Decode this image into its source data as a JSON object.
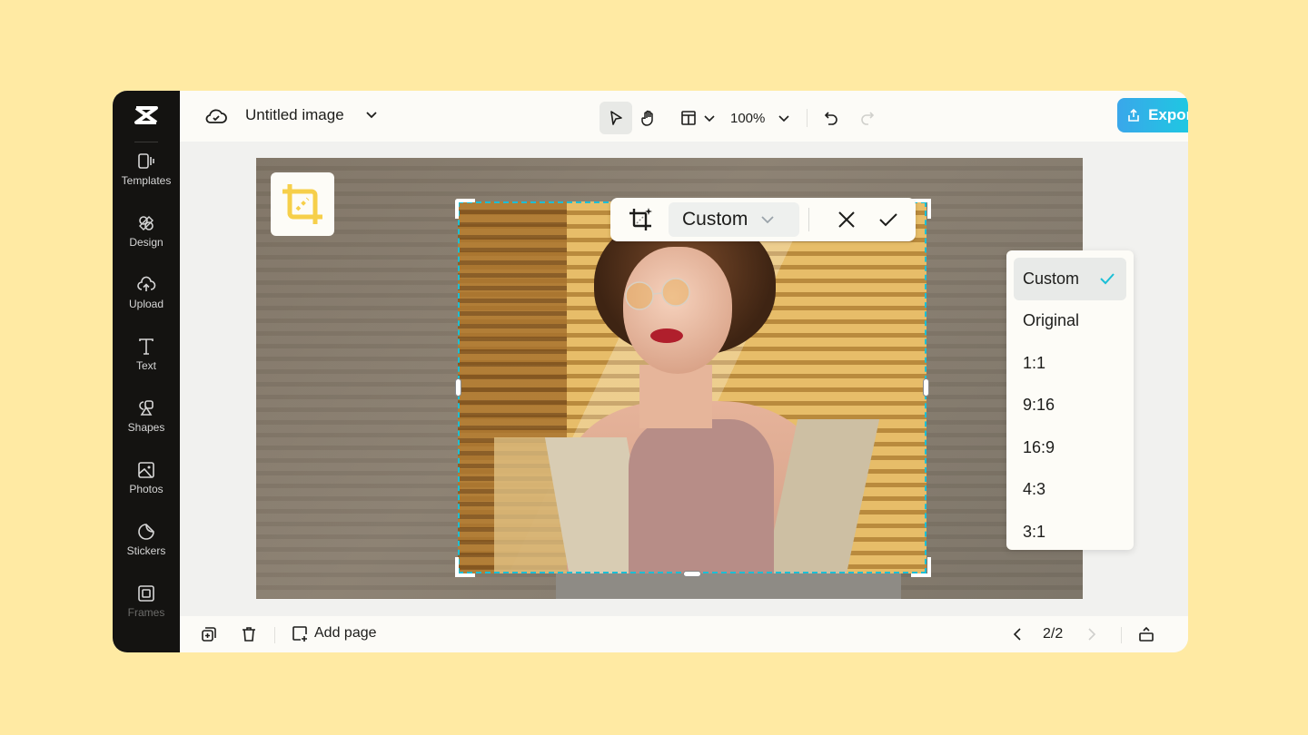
{
  "app": {
    "brand": "CapCut"
  },
  "sidebar": {
    "items": [
      {
        "label": "Templates",
        "icon": "templates-icon"
      },
      {
        "label": "Design",
        "icon": "design-icon"
      },
      {
        "label": "Upload",
        "icon": "upload-icon"
      },
      {
        "label": "Text",
        "icon": "text-icon"
      },
      {
        "label": "Shapes",
        "icon": "shapes-icon"
      },
      {
        "label": "Photos",
        "icon": "photos-icon"
      },
      {
        "label": "Stickers",
        "icon": "stickers-icon"
      },
      {
        "label": "Frames",
        "icon": "frames-icon"
      }
    ]
  },
  "topbar": {
    "title": "Untitled image",
    "zoom": "100%",
    "export_label": "Export",
    "accent_gradient": [
      "#3aa7ea",
      "#18cfe0"
    ]
  },
  "crop_toolbar": {
    "ratio_selected": "Custom"
  },
  "ratio_menu": {
    "options": [
      "Custom",
      "Original",
      "1:1",
      "9:16",
      "16:9",
      "4:3",
      "3:1"
    ],
    "selected": "Custom",
    "check_color": "#1bbfd6"
  },
  "bottombar": {
    "add_page_label": "Add page",
    "page_indicator": "2/2"
  },
  "colors": {
    "page_bg": "#ffeaa3",
    "sidebar_bg": "#141311",
    "crop_dash": "#1bbfd6",
    "crop_badge_icon": "#f6cf4a"
  }
}
